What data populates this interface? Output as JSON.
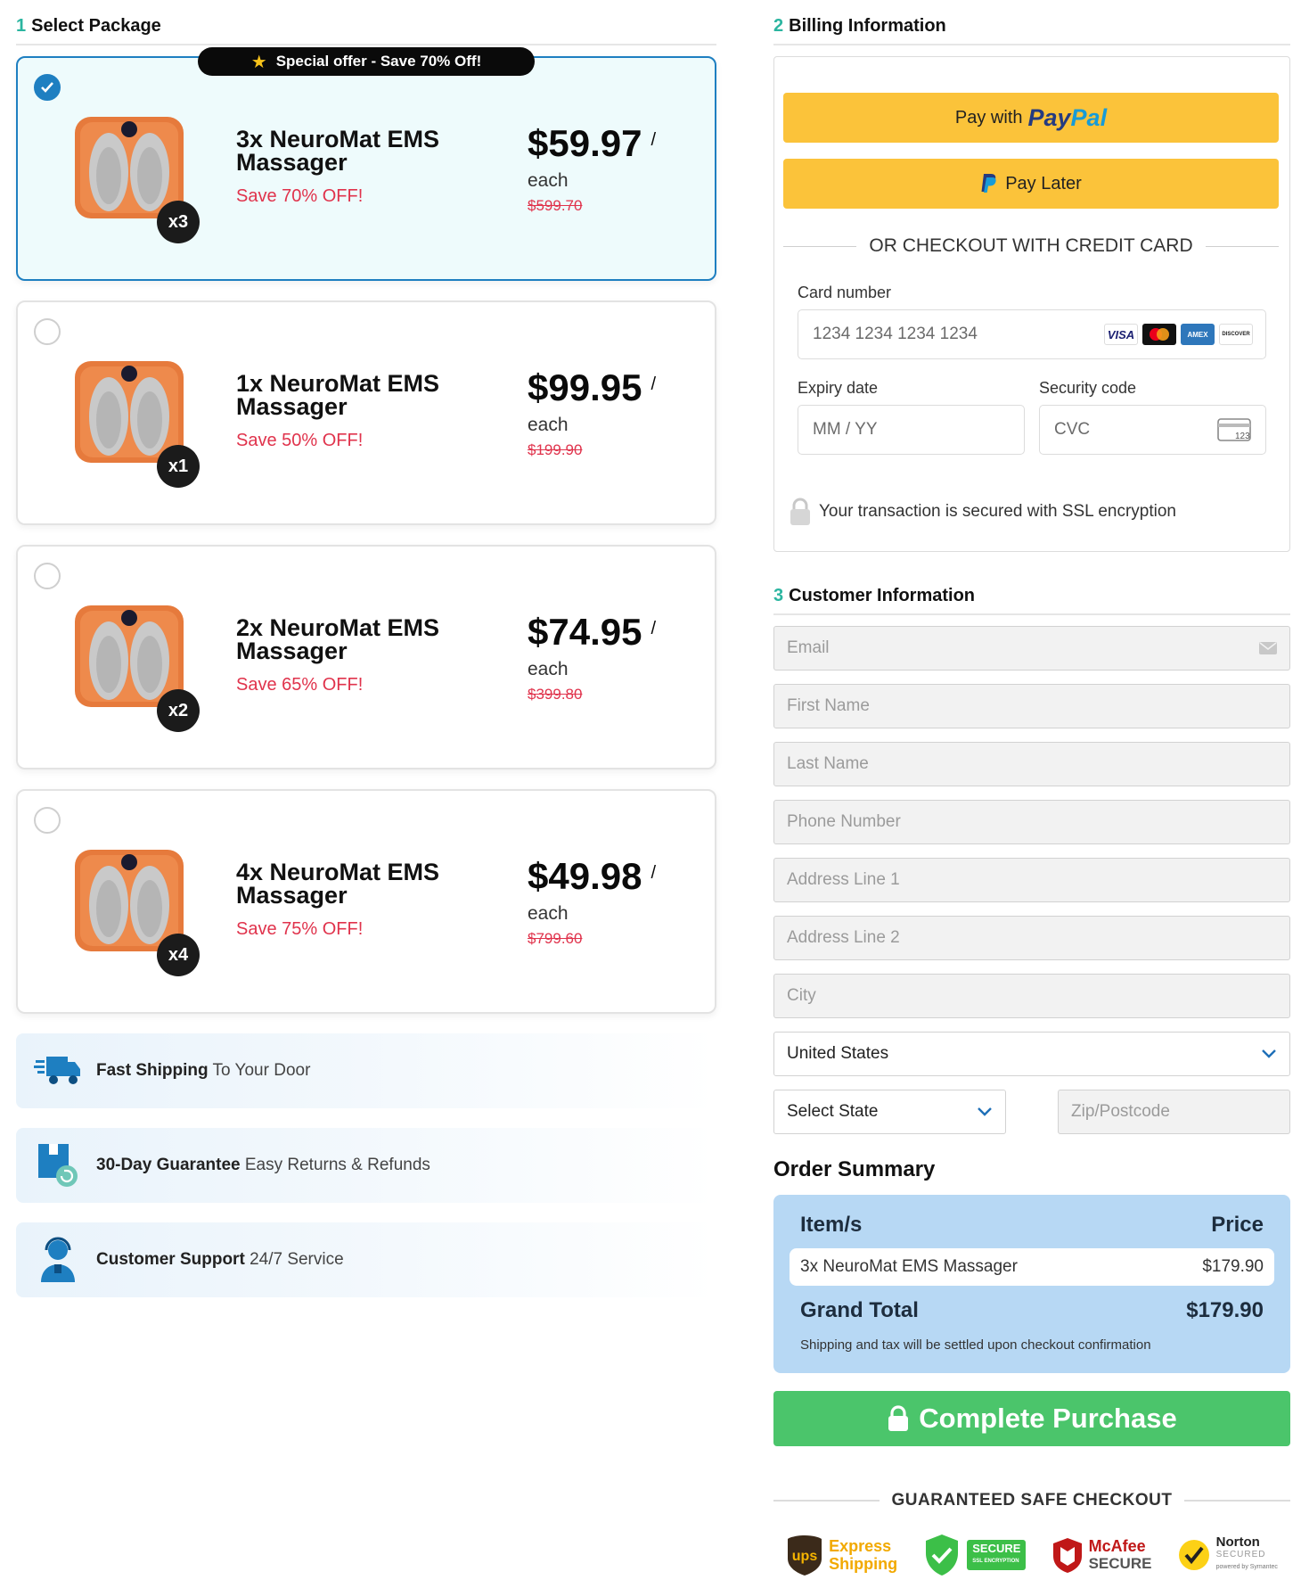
{
  "select_package": {
    "step": "1",
    "title": "Select Package",
    "offer_badge": "Special offer - Save 70% Off!",
    "packages": [
      {
        "qty": "x3",
        "name": "3x NeuroMat EMS Massager",
        "save": "Save 70% OFF!",
        "price": "$59.97",
        "slash": "/",
        "each": "each",
        "old_price": "$599.70",
        "selected": true
      },
      {
        "qty": "x1",
        "name": "1x NeuroMat EMS Massager",
        "save": "Save 50% OFF!",
        "price": "$99.95",
        "slash": "/",
        "each": "each",
        "old_price": "$199.90",
        "selected": false
      },
      {
        "qty": "x2",
        "name": "2x NeuroMat EMS Massager",
        "save": "Save 65% OFF!",
        "price": "$74.95",
        "slash": "/",
        "each": "each",
        "old_price": "$399.80",
        "selected": false
      },
      {
        "qty": "x4",
        "name": "4x NeuroMat EMS Massager",
        "save": "Save 75% OFF!",
        "price": "$49.98",
        "slash": "/",
        "each": "each",
        "old_price": "$799.60",
        "selected": false
      }
    ],
    "benefits": [
      {
        "bold": "Fast Shipping",
        "rest": "To Your Door",
        "icon": "truck-icon"
      },
      {
        "bold": "30-Day Guarantee",
        "rest": "Easy Returns & Refunds",
        "icon": "return-box-icon"
      },
      {
        "bold": "Customer Support",
        "rest": "24/7 Service",
        "icon": "support-agent-icon"
      }
    ]
  },
  "billing": {
    "step": "2",
    "title": "Billing Information",
    "pay_with": "Pay with",
    "paypal_a": "Pay",
    "paypal_b": "Pal",
    "pay_later": "Pay Later",
    "or_checkout": "OR CHECKOUT WITH CREDIT CARD",
    "card_number_label": "Card number",
    "card_number_placeholder": "1234 1234 1234 1234",
    "card_brands": [
      "VISA",
      "MC",
      "AMEX",
      "DISCOVER"
    ],
    "expiry_label": "Expiry date",
    "expiry_placeholder": "MM / YY",
    "security_label": "Security code",
    "security_placeholder": "CVC",
    "cvc_hint": "123",
    "ssl_text": "Your transaction is secured with SSL encryption"
  },
  "customer": {
    "step": "3",
    "title": "Customer Information",
    "email": "Email",
    "first_name": "First Name",
    "last_name": "Last Name",
    "phone": "Phone Number",
    "address1": "Address Line 1",
    "address2": "Address Line 2",
    "city": "City",
    "country": "United States",
    "state": "Select State",
    "zip": "Zip/Postcode"
  },
  "order_summary": {
    "title": "Order Summary",
    "col_item": "Item/s",
    "col_price": "Price",
    "item_name": "3x NeuroMat EMS Massager",
    "item_price": "$179.90",
    "total_label": "Grand Total",
    "total_value": "$179.90",
    "note": "Shipping and tax will be settled upon checkout confirmation",
    "button": "Complete Purchase",
    "safe_checkout": "GUARANTEED SAFE CHECKOUT",
    "trust": {
      "ups_a": "Express",
      "ups_b": "Shipping",
      "ups_logo": "ups",
      "secure": "SECURE",
      "secure_sub": "SSL ENCRYPTION",
      "mcafee_a": "McAfee",
      "mcafee_b": "SECURE",
      "norton_a": "Norton",
      "norton_b": "SECURED",
      "norton_c": "powered by Symantec"
    }
  },
  "colors": {
    "accent": "#1e7fc1",
    "teal": "#2bb5a0",
    "paypal_yellow": "#fbc33a",
    "save_red": "#e0334c",
    "buy_green": "#4bc56b",
    "summary_blue": "#b7d8f4"
  }
}
